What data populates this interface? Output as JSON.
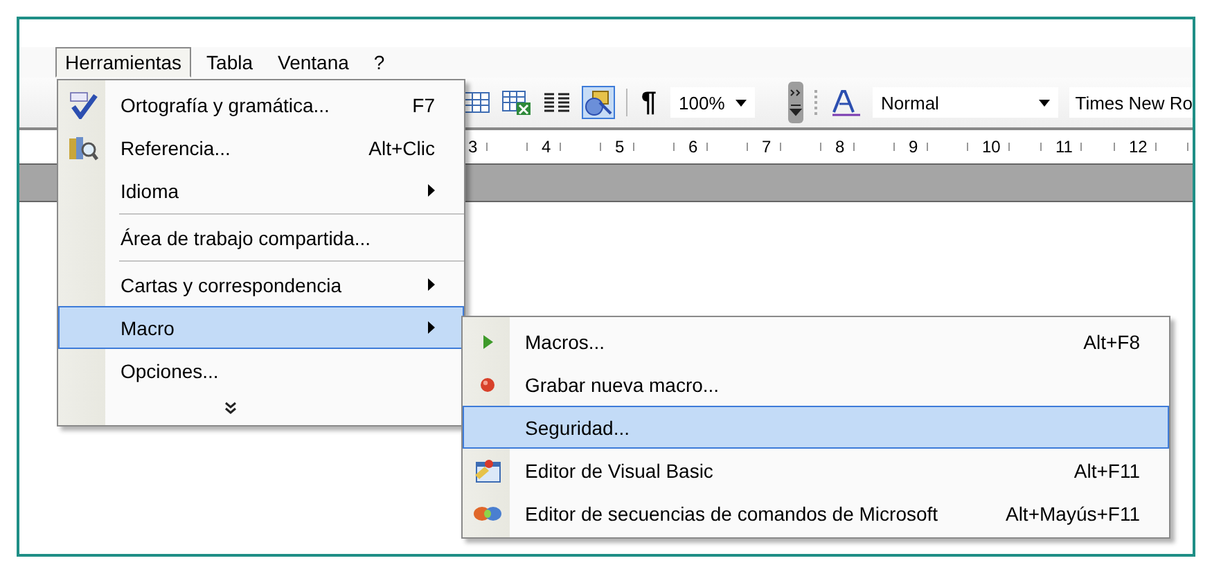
{
  "menubar": [
    {
      "label": "Herramientas",
      "selected": true
    },
    {
      "label": "Tabla",
      "selected": false
    },
    {
      "label": "Ventana",
      "selected": false
    },
    {
      "label": "?",
      "selected": false
    }
  ],
  "toolbar": {
    "pilcrow": "¶",
    "zoom": "100%",
    "style": "Normal",
    "font": "Times New Ro"
  },
  "ruler": {
    "numbers": [
      "3",
      "4",
      "5",
      "6",
      "7",
      "8",
      "9",
      "10",
      "11",
      "12"
    ]
  },
  "menu": {
    "items": [
      {
        "kind": "item",
        "label": "Ortografía y gramática...",
        "shortcut": "F7",
        "submenu": false,
        "selected": false
      },
      {
        "kind": "item",
        "label": "Referencia...",
        "shortcut": "Alt+Clic",
        "submenu": false,
        "selected": false
      },
      {
        "kind": "item",
        "label": "Idioma",
        "submenu": true,
        "selected": false
      },
      {
        "kind": "separator"
      },
      {
        "kind": "item",
        "label": "Área de trabajo compartida...",
        "submenu": false,
        "selected": false
      },
      {
        "kind": "separator"
      },
      {
        "kind": "item",
        "label": "Cartas y correspondencia",
        "submenu": true,
        "selected": false
      },
      {
        "kind": "item",
        "label": "Macro",
        "submenu": true,
        "selected": true
      },
      {
        "kind": "item",
        "label": "Opciones...",
        "submenu": false,
        "selected": false
      },
      {
        "kind": "more"
      }
    ]
  },
  "submenu": {
    "items": [
      {
        "kind": "item",
        "label": "Macros...",
        "shortcut": "Alt+F8",
        "selected": false
      },
      {
        "kind": "item",
        "label": "Grabar nueva macro...",
        "selected": false
      },
      {
        "kind": "item",
        "label": "Seguridad...",
        "selected": true
      },
      {
        "kind": "item",
        "label": "Editor de Visual Basic",
        "shortcut": "Alt+F11",
        "selected": false
      },
      {
        "kind": "item",
        "label": "Editor de secuencias de comandos de Microsoft",
        "shortcut": "Alt+Mayús+F11",
        "selected": false
      }
    ]
  }
}
